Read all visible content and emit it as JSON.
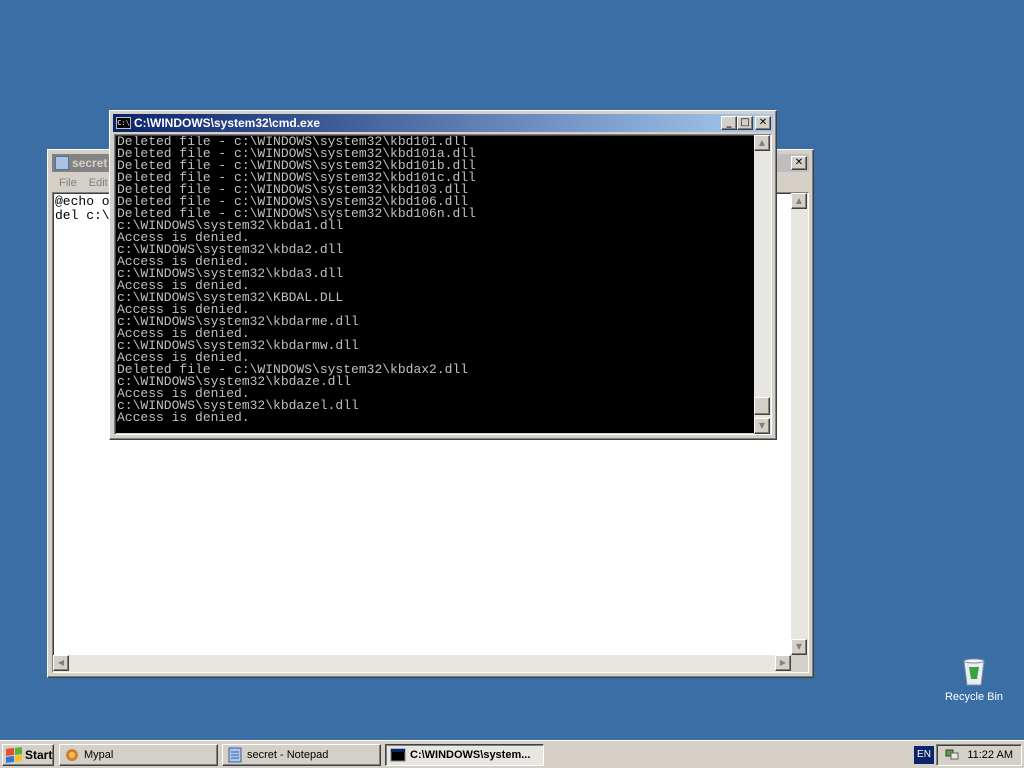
{
  "notepad": {
    "title": "secret",
    "menu": [
      "File",
      "Edit"
    ],
    "text_lines": [
      "@echo o",
      "del c:\\"
    ]
  },
  "cmd": {
    "title": "C:\\WINDOWS\\system32\\cmd.exe",
    "icon_label": "C:\\",
    "lines": [
      "Deleted file - c:\\WINDOWS\\system32\\kbd101.dll",
      "Deleted file - c:\\WINDOWS\\system32\\kbd101a.dll",
      "Deleted file - c:\\WINDOWS\\system32\\kbd101b.dll",
      "Deleted file - c:\\WINDOWS\\system32\\kbd101c.dll",
      "Deleted file - c:\\WINDOWS\\system32\\kbd103.dll",
      "Deleted file - c:\\WINDOWS\\system32\\kbd106.dll",
      "Deleted file - c:\\WINDOWS\\system32\\kbd106n.dll",
      "c:\\WINDOWS\\system32\\kbda1.dll",
      "Access is denied.",
      "c:\\WINDOWS\\system32\\kbda2.dll",
      "Access is denied.",
      "c:\\WINDOWS\\system32\\kbda3.dll",
      "Access is denied.",
      "c:\\WINDOWS\\system32\\KBDAL.DLL",
      "Access is denied.",
      "c:\\WINDOWS\\system32\\kbdarme.dll",
      "Access is denied.",
      "c:\\WINDOWS\\system32\\kbdarmw.dll",
      "Access is denied.",
      "Deleted file - c:\\WINDOWS\\system32\\kbdax2.dll",
      "c:\\WINDOWS\\system32\\kbdaze.dll",
      "Access is denied.",
      "c:\\WINDOWS\\system32\\kbdazel.dll",
      "Access is denied."
    ]
  },
  "desktop": {
    "recycle_bin_label": "Recycle Bin"
  },
  "taskbar": {
    "start_label": "Start",
    "tasks": [
      {
        "label": "Mypal",
        "active": false
      },
      {
        "label": "secret - Notepad",
        "active": false
      },
      {
        "label": "C:\\WINDOWS\\system...",
        "active": true
      }
    ],
    "language": "EN",
    "clock": "11:22 AM"
  },
  "colors": {
    "desktop": "#3a6ea5",
    "active_title_start": "#0a246a",
    "active_title_end": "#a6caf0",
    "inactive_title_start": "#808080",
    "console_bg": "#000000",
    "console_fg": "#c0c0c0"
  }
}
